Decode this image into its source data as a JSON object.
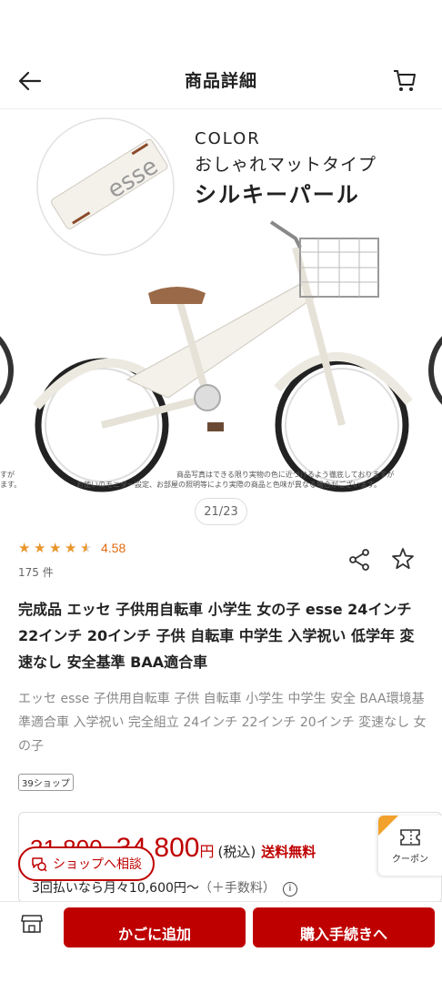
{
  "header": {
    "title": "商品詳細",
    "back_icon": "back-arrow-icon",
    "cart_icon": "cart-icon"
  },
  "carousel": {
    "color_label": "COLOR",
    "color_subtitle": "おしゃれマットタイプ",
    "color_name": "シルキーパール",
    "emblem_text": "esse",
    "disclaimer_line1": "商品写真はできる限り実物の色に近づけるよう徹底しておりますが",
    "disclaimer_line2": "お使いのモニター設定、お部屋の照明等により実際の商品と色味が異なる場合がございます。",
    "left_edge_line1": "すが",
    "left_edge_line2": "ます。",
    "counter": "21/23"
  },
  "rating": {
    "value": "4.58",
    "stars": 4.5,
    "review_count": "175 件"
  },
  "product": {
    "title": "完成品 エッセ 子供用自転車 小学生 女の子 esse 24インチ 22インチ 20インチ 子供 自転車 中学生 入学祝い 低学年 変速なし 安全基準 BAA適合車",
    "description": "エッセ esse 子供用自転車 子供 自転車 小学生 中学生 安全 BAA環境基準適合車 入学祝い 完全組立 24インチ 22インチ 20インチ 変速なし 女の子",
    "shop_badge": "39ショップ"
  },
  "price": {
    "original": "31,800",
    "separator": "~",
    "current": "34,800",
    "yen": "円",
    "tax": "(税込)",
    "shipping": "送料無料",
    "installment": "3回払いなら月々10,600円〜",
    "installment_fee": "（＋手数料）",
    "info_icon": "info-icon"
  },
  "floating": {
    "shop_consult": "ショップへ相談",
    "coupon": "クーポン"
  },
  "actions": {
    "add_to_cart": "かごに追加",
    "checkout": "購入手続きへ"
  },
  "colors": {
    "accent": "#bf0000",
    "rating": "#e8962c"
  }
}
